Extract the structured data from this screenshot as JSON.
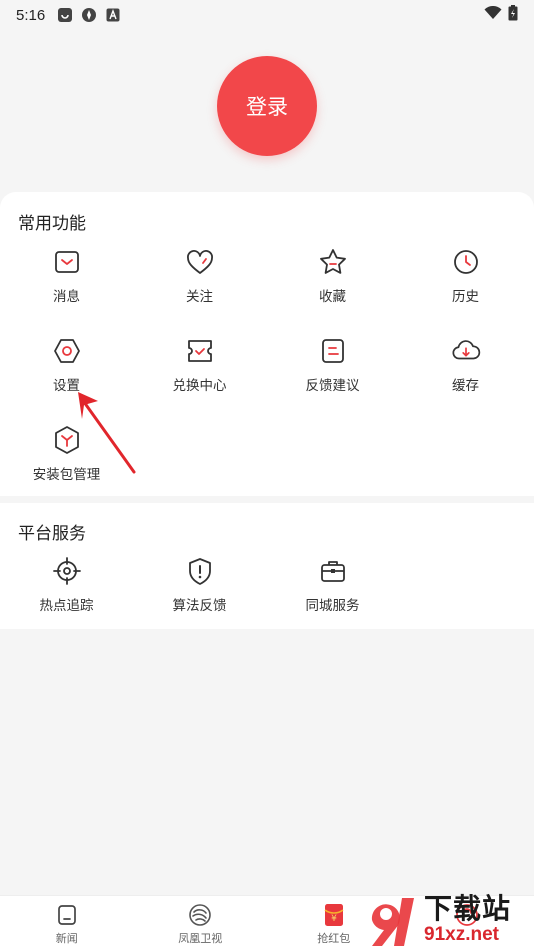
{
  "status_bar": {
    "time": "5:16"
  },
  "login": {
    "label": "登录"
  },
  "common": {
    "title": "常用功能",
    "items": [
      {
        "label": "消息",
        "icon": "message-icon"
      },
      {
        "label": "关注",
        "icon": "heart-icon"
      },
      {
        "label": "收藏",
        "icon": "star-icon"
      },
      {
        "label": "历史",
        "icon": "clock-icon"
      },
      {
        "label": "设置",
        "icon": "hexagon-gear-icon"
      },
      {
        "label": "兑换中心",
        "icon": "ticket-icon"
      },
      {
        "label": "反馈建议",
        "icon": "feedback-icon"
      },
      {
        "label": "缓存",
        "icon": "cloud-download-icon"
      },
      {
        "label": "安装包管理",
        "icon": "package-icon"
      }
    ]
  },
  "platform": {
    "title": "平台服务",
    "items": [
      {
        "label": "热点追踪",
        "icon": "crosshair-icon"
      },
      {
        "label": "算法反馈",
        "icon": "shield-alert-icon"
      },
      {
        "label": "同城服务",
        "icon": "briefcase-icon"
      }
    ]
  },
  "bottom_nav": [
    {
      "label": "新闻",
      "icon": "news-icon"
    },
    {
      "label": "凤凰卫视",
      "icon": "phoenix-icon"
    },
    {
      "label": "抢红包",
      "icon": "red-packet-icon"
    },
    {
      "label": "",
      "icon": "profile-icon"
    }
  ],
  "watermark": {
    "line1": "下载站",
    "line2": "91xz.net"
  },
  "colors": {
    "accent": "#f2474a",
    "icon": "#333333",
    "icon_accent": "#e8383d"
  }
}
